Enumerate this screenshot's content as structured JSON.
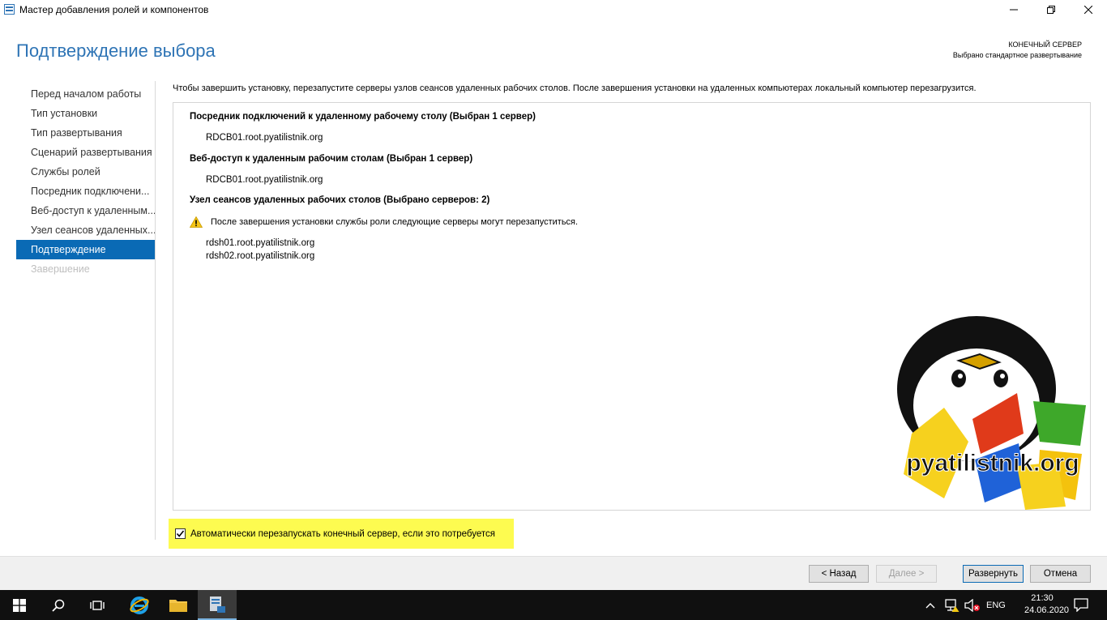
{
  "window": {
    "title": "Мастер добавления ролей и компонентов"
  },
  "header": {
    "page_title": "Подтверждение выбора",
    "destination_label": "КОНЕЧНЫЙ СЕРВЕР",
    "destination_value": "Выбрано стандартное развертывание"
  },
  "nav": {
    "items": [
      {
        "label": "Перед началом работы",
        "state": "normal"
      },
      {
        "label": "Тип установки",
        "state": "normal"
      },
      {
        "label": "Тип развертывания",
        "state": "normal"
      },
      {
        "label": "Сценарий развертывания",
        "state": "normal"
      },
      {
        "label": "Службы ролей",
        "state": "normal"
      },
      {
        "label": "Посредник подключени...",
        "state": "normal"
      },
      {
        "label": "Веб-доступ к удаленным...",
        "state": "normal"
      },
      {
        "label": "Узел сеансов удаленных...",
        "state": "normal"
      },
      {
        "label": "Подтверждение",
        "state": "active"
      },
      {
        "label": "Завершение",
        "state": "disabled"
      }
    ]
  },
  "main": {
    "instruction": "Чтобы завершить установку, перезапустите серверы узлов сеансов удаленных рабочих столов. После завершения установки на удаленных компьютерах локальный компьютер перезагрузится.",
    "sections": [
      {
        "title": "Посредник подключений к удаленному рабочему столу  (Выбран 1 сервер)",
        "servers": [
          "RDCB01.root.pyatilistnik.org"
        ]
      },
      {
        "title": "Веб-доступ к удаленным рабочим столам  (Выбран 1 сервер)",
        "servers": [
          "RDCB01.root.pyatilistnik.org"
        ]
      },
      {
        "title": "Узел сеансов удаленных рабочих столов  (Выбрано серверов: 2)",
        "servers": [
          "rdsh01.root.pyatilistnik.org",
          "rdsh02.root.pyatilistnik.org"
        ]
      }
    ],
    "warning": "После завершения установки службы роли следующие серверы могут перезапуститься.",
    "watermark": "pyatilistnik.org"
  },
  "restart_checkbox": {
    "label": "Автоматически перезапускать конечный сервер, если это потребуется",
    "checked": true
  },
  "buttons": {
    "back": "< Назад",
    "next": "Далее >",
    "deploy": "Развернуть",
    "cancel": "Отмена"
  },
  "taskbar": {
    "language": "ENG",
    "time": "21:30",
    "date": "24.06.2020"
  },
  "colors": {
    "accent": "#0a6ab5",
    "title_blue": "#2e74b5",
    "highlight": "#fdfb50",
    "taskbar": "#101010"
  }
}
